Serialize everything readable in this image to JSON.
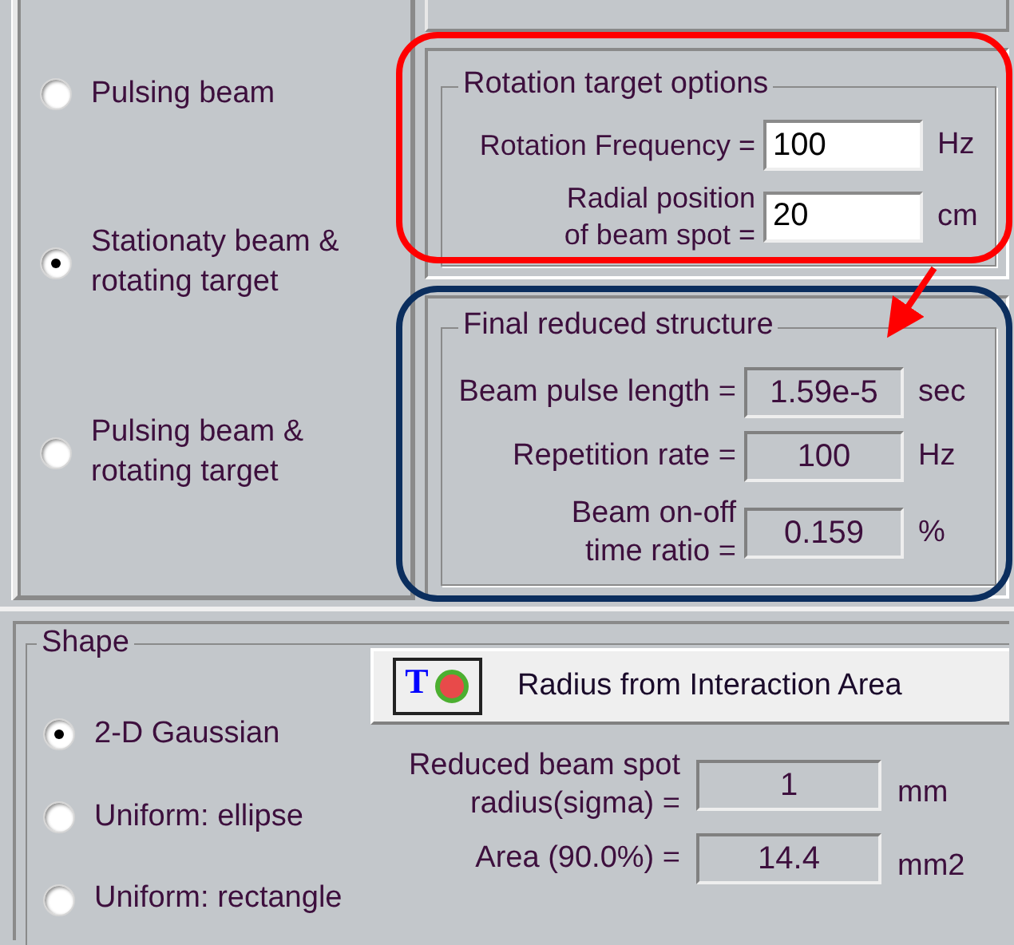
{
  "beam_modes": [
    {
      "label": "Pulsing beam",
      "selected": false
    },
    {
      "label": "Stationaty beam &\nrotating target",
      "selected": true
    },
    {
      "label": "Pulsing beam &\nrotating target",
      "selected": false
    }
  ],
  "rotation_target_options": {
    "title": "Rotation target options",
    "rows": [
      {
        "label": "Rotation Frequency =",
        "value": "100",
        "unit": "Hz"
      },
      {
        "label": "Radial position\nof beam spot  =",
        "value": "20",
        "unit": "cm"
      }
    ]
  },
  "final_reduced_structure": {
    "title": "Final reduced structure",
    "rows": [
      {
        "label": "Beam pulse length =",
        "value": "1.59e-5",
        "unit": "sec"
      },
      {
        "label": "Repetition rate =",
        "value": "100",
        "unit": "Hz"
      },
      {
        "label": "Beam on-off\ntime ratio =",
        "value": "0.159",
        "unit": "%"
      }
    ]
  },
  "shape": {
    "title": "Shape",
    "options": [
      {
        "label": "2-D Gaussian",
        "selected": true
      },
      {
        "label": "Uniform: ellipse",
        "selected": false
      },
      {
        "label": "Uniform: rectangle",
        "selected": false
      }
    ],
    "button": {
      "icon_letter": "T",
      "label": "Radius from Interaction Area"
    },
    "rows": [
      {
        "label": "Reduced beam spot\nradius(sigma) =",
        "value": "1",
        "unit": "mm"
      },
      {
        "label": "Area (90.0%) =",
        "value": "14.4",
        "unit": "mm2"
      }
    ]
  }
}
